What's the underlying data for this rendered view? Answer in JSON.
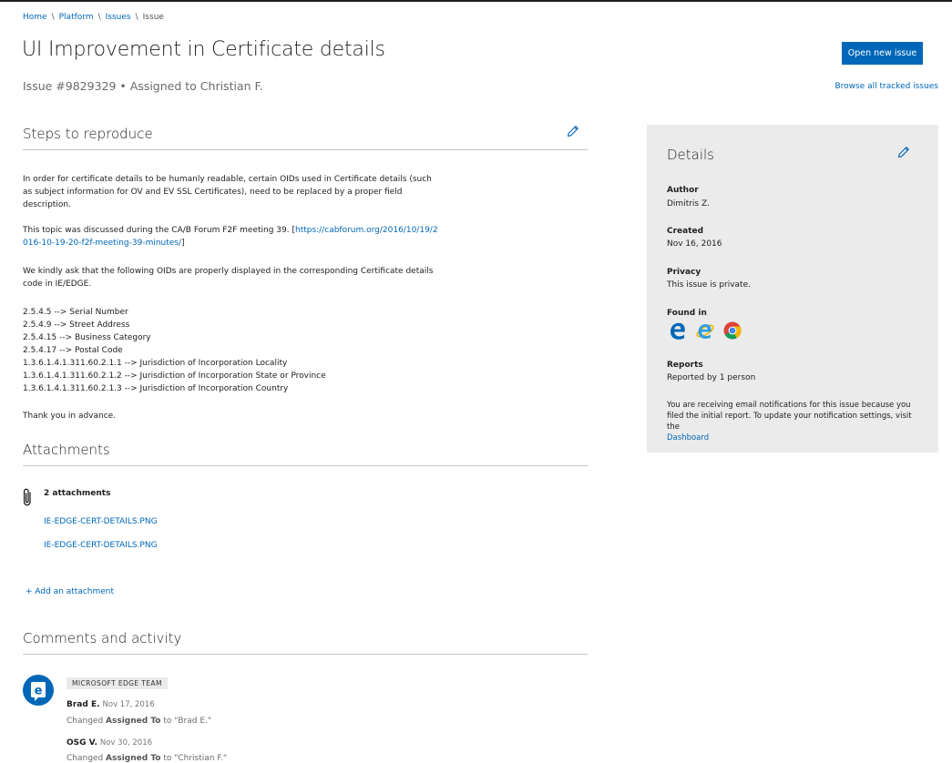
{
  "breadcrumb": [
    "Home",
    "Platform",
    "Issues",
    "Issue"
  ],
  "page": {
    "title": "UI Improvement in Certificate details",
    "subtitle": "Issue #9829329 • Assigned to Christian F."
  },
  "actions": {
    "open_new_issue": "Open new issue",
    "browse_all": "Browse all tracked issues"
  },
  "steps": {
    "heading": "Steps to reproduce",
    "para1": "In order for certificate details to be humanly readable, certain OIDs used in Certificate details (such as subject information for OV and EV SSL Certificates), need to be replaced by a proper field description.",
    "para2_prefix": "This topic was discussed during the CA/B Forum F2F meeting 39. [",
    "para2_link": "https://cabforum.org/2016/10/19/2016-10-19-20-f2f-meeting-39-minutes/",
    "para2_suffix": "]",
    "para3": "We kindly ask that the following OIDs are properly displayed in the corresponding Certificate details code in IE/EDGE.",
    "oids": [
      "2.5.4.5 --> Serial Number",
      "2.5.4.9 --> Street Address",
      "2.5.4.15 --> Business Category",
      "2.5.4.17 --> Postal Code",
      "1.3.6.1.4.1.311.60.2.1.1 --> Jurisdiction of Incorporation Locality",
      "1.3.6.1.4.1.311.60.2.1.2 --> Jurisdiction of Incorporation State or Province",
      "1.3.6.1.4.1.311.60.2.1.3 --> Jurisdiction of Incorporation Country"
    ],
    "closing": "Thank you in advance."
  },
  "attachments": {
    "heading": "Attachments",
    "count_label": "2 attachments",
    "files": [
      "IE-EDGE-CERT-DETAILS.PNG",
      "IE-EDGE-CERT-DETAILS.PNG"
    ],
    "add_label": "+ Add an attachment"
  },
  "comments": {
    "heading": "Comments and activity",
    "team_badge": "MICROSOFT EDGE TEAM",
    "entries": [
      {
        "name": "Brad E.",
        "date": "Nov 17, 2016",
        "pre": "Changed ",
        "field": "Assigned To",
        "post": " to \"Brad E.\""
      },
      {
        "name": "OSG V.",
        "date": "Nov 30, 2016",
        "pre": "Changed ",
        "field": "Assigned To",
        "post": " to \"Christian F.\""
      }
    ]
  },
  "details": {
    "heading": "Details",
    "author_label": "Author",
    "author": "Dimitris Z.",
    "created_label": "Created",
    "created": "Nov 16, 2016",
    "privacy_label": "Privacy",
    "privacy": "This issue is private.",
    "found_in_label": "Found in",
    "found_in_icons": [
      "edge-icon",
      "internet-explorer-icon",
      "chrome-icon"
    ],
    "reports_label": "Reports",
    "reports": "Reported by 1 person",
    "note": "You are receiving email notifications for this issue because you filed the initial report. To update your notification settings, visit the",
    "note_link": "Dashboard"
  },
  "colors": {
    "accent": "#0067b8",
    "panel": "#ebebeb",
    "rule": "#c8c8c8"
  }
}
